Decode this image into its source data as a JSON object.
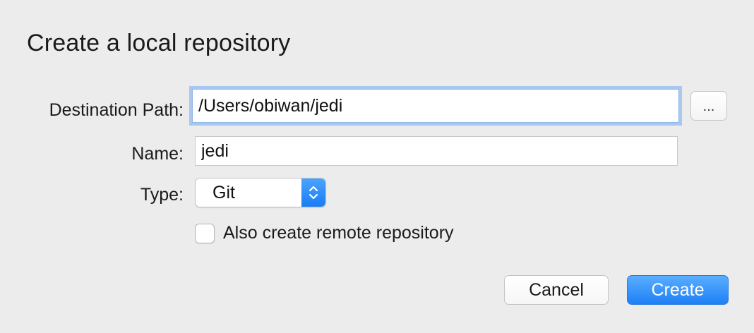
{
  "dialog": {
    "title": "Create a local repository"
  },
  "form": {
    "destination_path": {
      "label": "Destination Path:",
      "value": "/Users/obiwan/jedi"
    },
    "browse_button_label": "...",
    "name": {
      "label": "Name:",
      "value": "jedi"
    },
    "type": {
      "label": "Type:",
      "selected": "Git"
    },
    "remote_checkbox": {
      "label": "Also create remote repository",
      "checked": false
    }
  },
  "buttons": {
    "cancel_label": "Cancel",
    "create_label": "Create"
  },
  "colors": {
    "accent": "#1e80f6",
    "focus_ring": "#a8c8f0",
    "background": "#ececec"
  },
  "icons": {
    "type_stepper": "up-down-chevron-icon"
  }
}
